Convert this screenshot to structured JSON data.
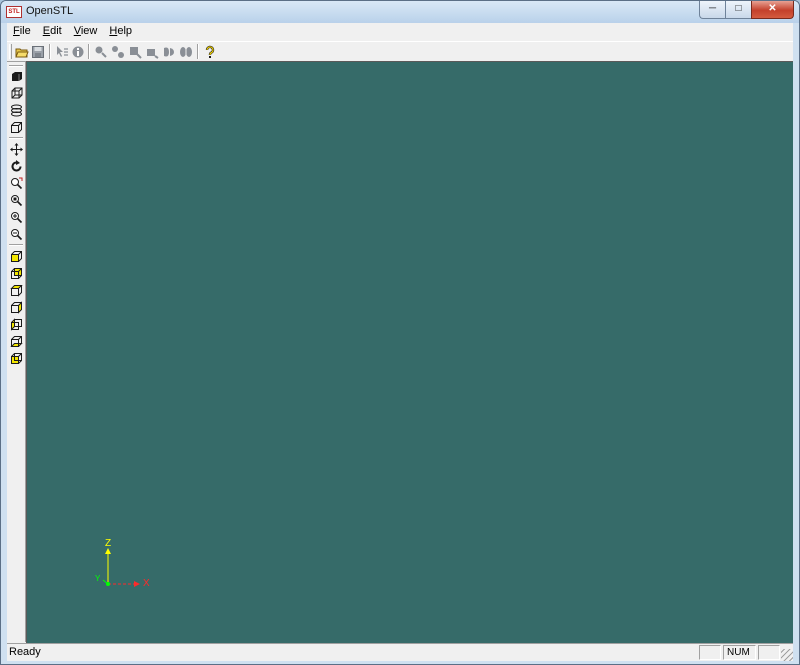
{
  "window": {
    "title": "OpenSTL",
    "app_icon_text": "STL"
  },
  "caption_buttons": {
    "minimize": "─",
    "maximize": "□",
    "close": "✕"
  },
  "menu": [
    {
      "label": "File",
      "mnemonic": "F",
      "rest": "ile"
    },
    {
      "label": "Edit",
      "mnemonic": "E",
      "rest": "dit"
    },
    {
      "label": "View",
      "mnemonic": "V",
      "rest": "iew"
    },
    {
      "label": "Help",
      "mnemonic": "H",
      "rest": "elp"
    }
  ],
  "toolbar_icons": [
    "open-folder-icon",
    "save-icon",
    "select-info-icon",
    "info-icon",
    "point-icon",
    "vertex-icon",
    "surface-icon",
    "solid-icon",
    "shade-icon",
    "mirror-icon",
    "help-icon"
  ],
  "left_toolbar_icons": [
    "solid-view-icon",
    "wireframe-icon",
    "slice-icon",
    "box-icon",
    "pan-icon",
    "rotate-icon",
    "zoom-window-icon",
    "zoom-fit-icon",
    "zoom-in-icon",
    "zoom-out-icon",
    "view-top-icon",
    "view-bottom-icon",
    "view-front-icon",
    "view-back-icon",
    "view-left-icon",
    "view-right-icon",
    "view-iso-icon"
  ],
  "viewport": {
    "background": "#366b69"
  },
  "axes": {
    "z_label": "Z",
    "x_label": "X",
    "y_label": "Y",
    "z_color": "#ffff00",
    "x_color": "#ff2a2a",
    "y_color": "#00ff00"
  },
  "status": {
    "text": "Ready",
    "panes": [
      "",
      "NUM",
      ""
    ]
  }
}
